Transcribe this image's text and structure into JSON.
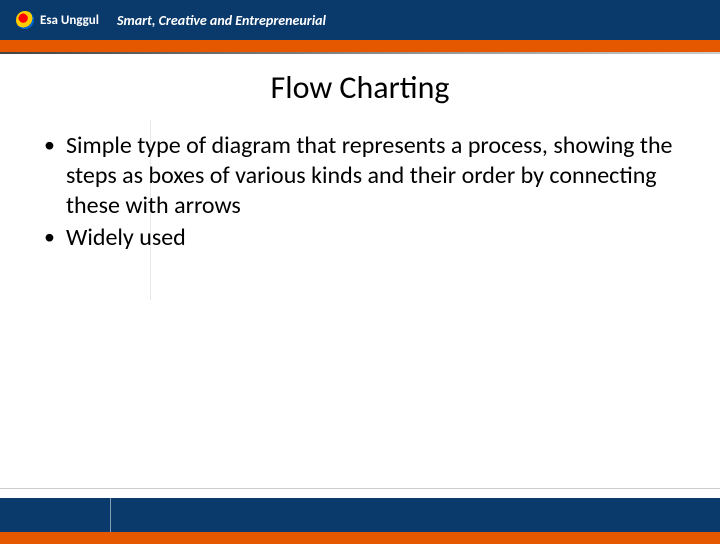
{
  "header": {
    "brand": "Esa Unggul",
    "tagline": "Smart, Creative and Entrepreneurial"
  },
  "slide": {
    "title": "Flow Charting",
    "bullets": [
      "Simple type of diagram that represents a process, showing the steps as boxes of various kinds and their order by connecting these with arrows",
      "Widely used"
    ]
  },
  "colors": {
    "navy": "#0a3a6b",
    "orange": "#e55800"
  }
}
